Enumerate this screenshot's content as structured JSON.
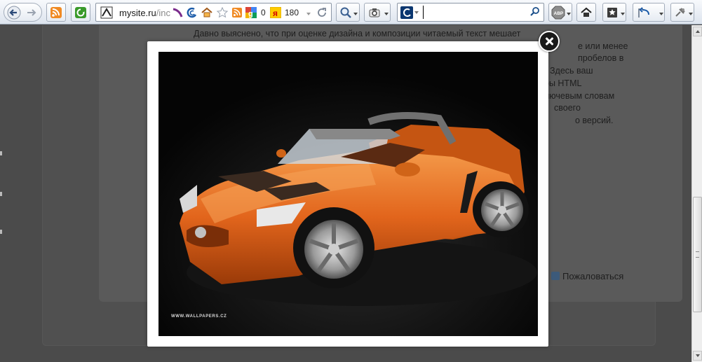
{
  "toolbar": {
    "url_host": "mysite.ru",
    "url_path": "/inc",
    "counter_a": "0",
    "counter_b": "180",
    "search_placeholder": ""
  },
  "article": {
    "lines": [
      "Давно выяснено, что при оценке дизайна и композиции читаемый текст мешает",
      "е или менее",
      "пробелов в",
      "Здесь ваш",
      "ры HTML",
      "лючевым словам",
      "своего",
      "о версий."
    ]
  },
  "report_label": "Пожаловаться",
  "lightbox": {
    "watermark": "WWW.WALLPAPERS.CZ"
  },
  "colors": {
    "car_body": "#e2651c",
    "car_highlight": "#f49a4a",
    "backdrop": "#050505",
    "overlay": "#4b4b4b"
  },
  "icons": [
    "back-arrow-icon",
    "forward-arrow-icon",
    "rss-icon",
    "refresh-green-icon",
    "site-favicon",
    "feather-icon",
    "browser-icon",
    "home-icon",
    "star-icon",
    "rss-small-icon",
    "google-icon",
    "yandex-icon",
    "reload-icon",
    "search-icon",
    "camera-icon",
    "yandex-search-icon",
    "adblock-icon",
    "home-button-icon",
    "bookmark-icon",
    "share-icon",
    "settings-icon"
  ]
}
